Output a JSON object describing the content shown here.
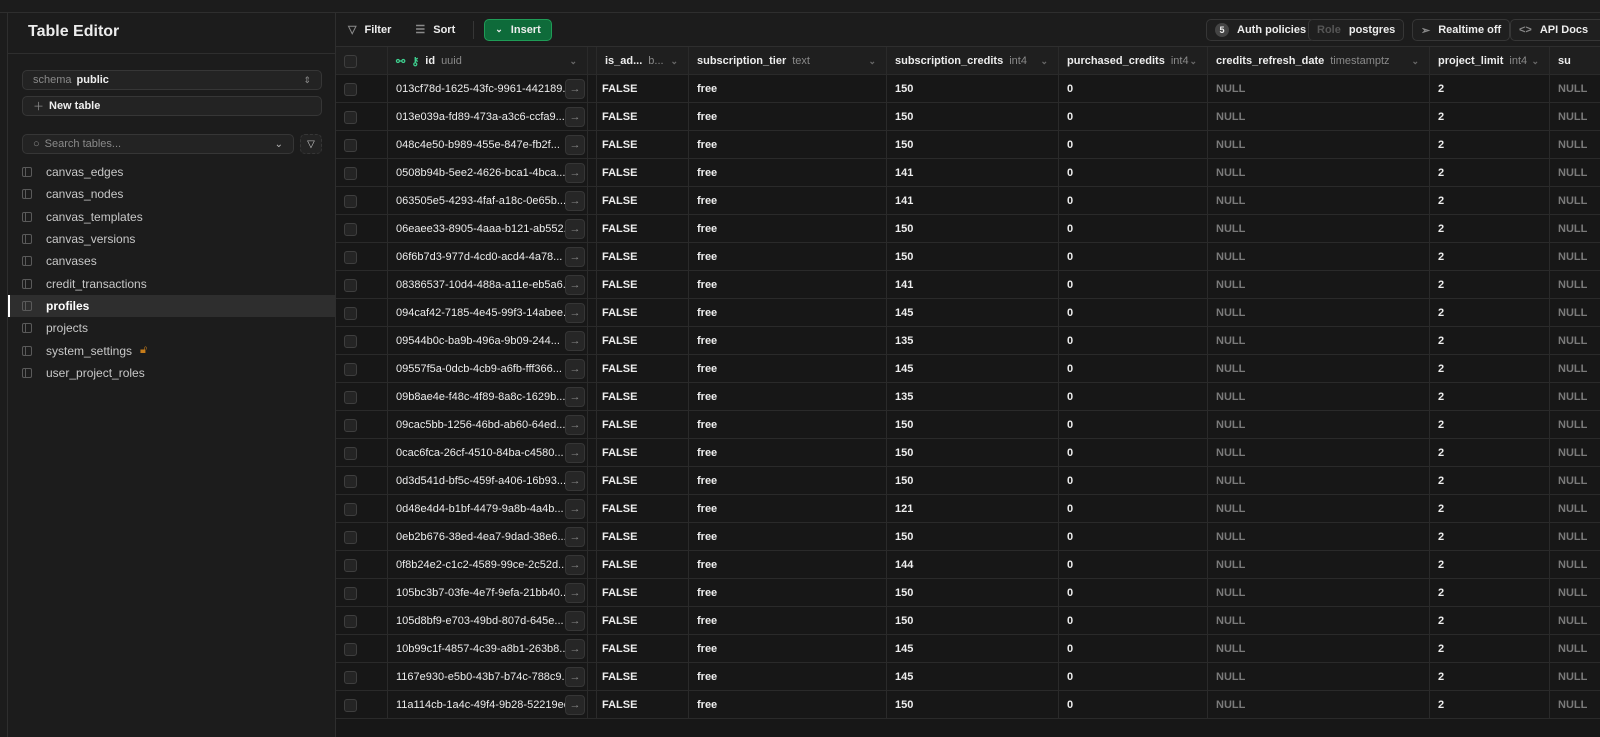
{
  "sidebar": {
    "title": "Table Editor",
    "schema_label": "schema",
    "schema_value": "public",
    "new_table": "New table",
    "search_placeholder": "Search tables...",
    "tables": [
      {
        "name": "canvas_edges"
      },
      {
        "name": "canvas_nodes"
      },
      {
        "name": "canvas_templates"
      },
      {
        "name": "canvas_versions"
      },
      {
        "name": "canvases"
      },
      {
        "name": "credit_transactions"
      },
      {
        "name": "profiles",
        "active": true
      },
      {
        "name": "projects"
      },
      {
        "name": "system_settings",
        "locked": true
      },
      {
        "name": "user_project_roles"
      }
    ]
  },
  "toolbar": {
    "filter": "Filter",
    "sort": "Sort",
    "insert": "Insert",
    "auth_count": "5",
    "auth_policies": "Auth policies",
    "role_label": "Role",
    "role_value": "postgres",
    "realtime": "Realtime off",
    "api_docs": "API Docs"
  },
  "colors": {
    "accent": "#0e6b3a",
    "lock": "#c77d1a",
    "link_key": "#3ecf8e"
  },
  "columns": [
    {
      "name": "id",
      "type": "uuid"
    },
    {
      "name": "is_ad...",
      "type": "b..."
    },
    {
      "name": "subscription_tier",
      "type": "text"
    },
    {
      "name": "subscription_credits",
      "type": "int4"
    },
    {
      "name": "purchased_credits",
      "type": "int4"
    },
    {
      "name": "credits_refresh_date",
      "type": "timestamptz"
    },
    {
      "name": "project_limit",
      "type": "int4"
    },
    {
      "name": "su",
      "type": ""
    }
  ],
  "rows": [
    {
      "id": "013cf78d-1625-43fc-9961-442189...",
      "credits": "150"
    },
    {
      "id": "013e039a-fd89-473a-a3c6-ccfa9...",
      "credits": "150"
    },
    {
      "id": "048c4e50-b989-455e-847e-fb2f...",
      "credits": "150"
    },
    {
      "id": "0508b94b-5ee2-4626-bca1-4bca...",
      "credits": "141"
    },
    {
      "id": "063505e5-4293-4faf-a18c-0e65b...",
      "credits": "141"
    },
    {
      "id": "06eaee33-8905-4aaa-b121-ab552...",
      "credits": "150"
    },
    {
      "id": "06f6b7d3-977d-4cd0-acd4-4a78...",
      "credits": "150"
    },
    {
      "id": "08386537-10d4-488a-a11e-eb5a6...",
      "credits": "141"
    },
    {
      "id": "094caf42-7185-4e45-99f3-14abee...",
      "credits": "145"
    },
    {
      "id": "09544b0c-ba9b-496a-9b09-244...",
      "credits": "135"
    },
    {
      "id": "09557f5a-0dcb-4cb9-a6fb-fff366...",
      "credits": "145"
    },
    {
      "id": "09b8ae4e-f48c-4f89-8a8c-1629b...",
      "credits": "135"
    },
    {
      "id": "09cac5bb-1256-46bd-ab60-64ed...",
      "credits": "150"
    },
    {
      "id": "0cac6fca-26cf-4510-84ba-c4580...",
      "credits": "150"
    },
    {
      "id": "0d3d541d-bf5c-459f-a406-16b93...",
      "credits": "150"
    },
    {
      "id": "0d48e4d4-b1bf-4479-9a8b-4a4b...",
      "credits": "121"
    },
    {
      "id": "0eb2b676-38ed-4ea7-9dad-38e6...",
      "credits": "150"
    },
    {
      "id": "0f8b24e2-c1c2-4589-99ce-2c52d...",
      "credits": "144"
    },
    {
      "id": "105bc3b7-03fe-4e7f-9efa-21bb40...",
      "credits": "150"
    },
    {
      "id": "105d8bf9-e703-49bd-807d-645e...",
      "credits": "150"
    },
    {
      "id": "10b99c1f-4857-4c39-a8b1-263b8...",
      "credits": "145"
    },
    {
      "id": "1167e930-e5b0-43b7-b74c-788c9...",
      "credits": "145"
    },
    {
      "id": "11a114cb-1a4c-49f4-9b28-52219ec...",
      "credits": "150"
    }
  ],
  "defaults": {
    "is_admin": "FALSE",
    "tier": "free",
    "purchased": "0",
    "refresh": "NULL",
    "limit": "2",
    "next": "NULL"
  }
}
